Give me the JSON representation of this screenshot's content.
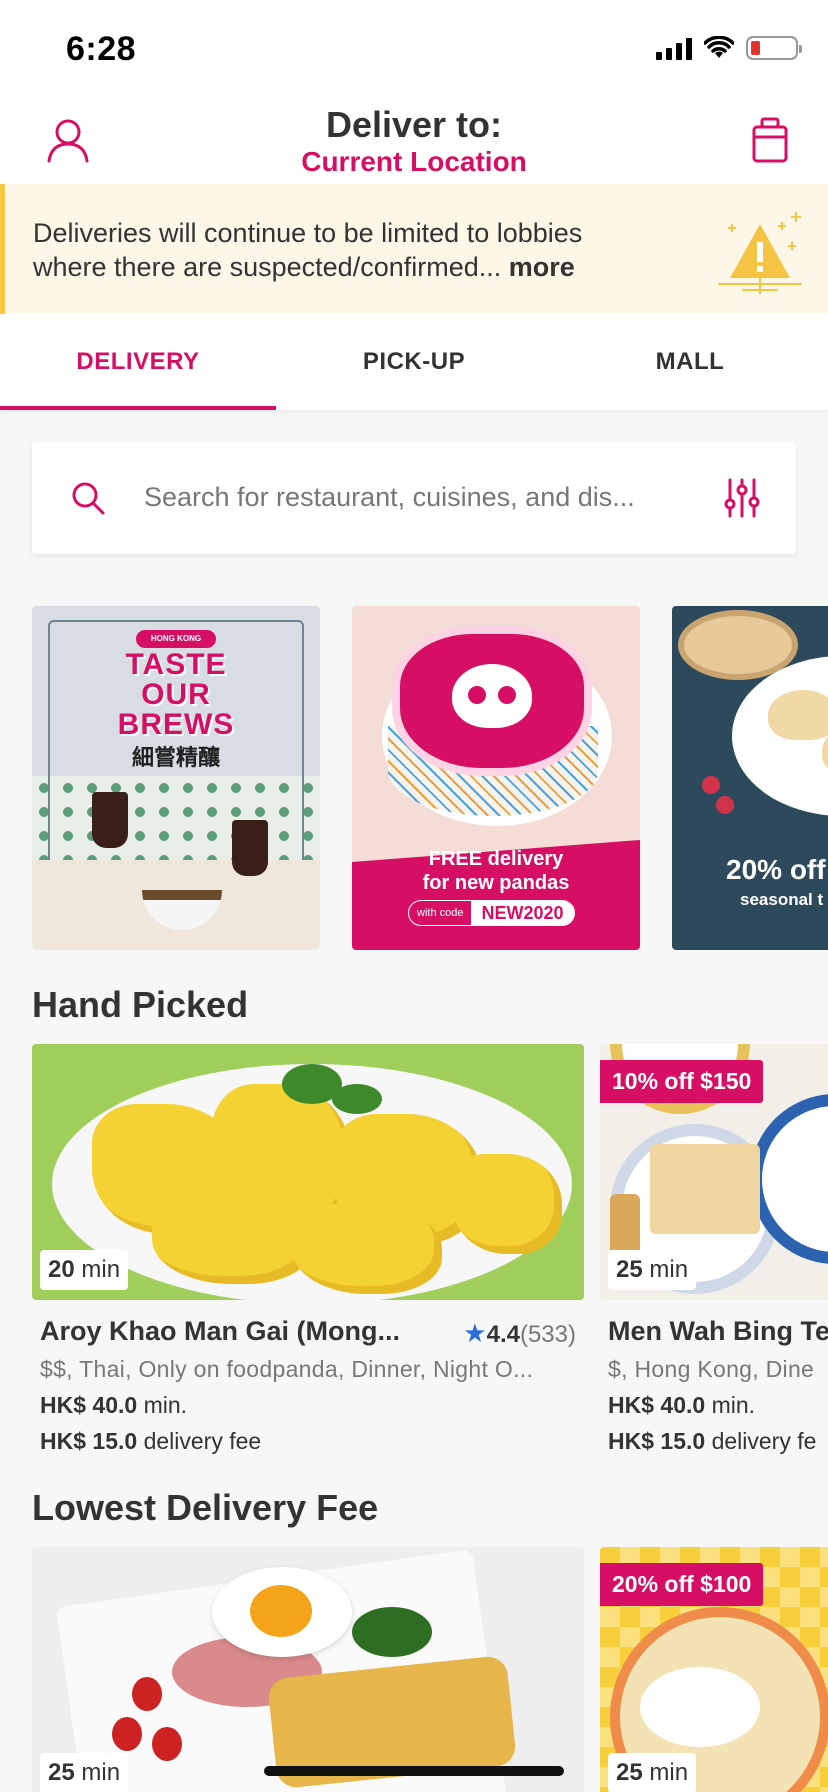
{
  "status_bar": {
    "time": "6:28"
  },
  "header": {
    "title": "Deliver to:",
    "location": "Current Location"
  },
  "notice": {
    "text": "Deliveries will continue to be limited to lobbies where there are suspected/confirmed...",
    "more_label": "more"
  },
  "tabs": [
    {
      "label": "DELIVERY",
      "active": true
    },
    {
      "label": "PICK-UP",
      "active": false
    },
    {
      "label": "MALL",
      "active": false
    }
  ],
  "search": {
    "placeholder": "Search for restaurant, cuisines, and dis..."
  },
  "banners": [
    {
      "brand": "HONG KONG",
      "title_lines": [
        "TASTE",
        "OUR",
        "BREWS"
      ],
      "subtitle": "細嘗精釀"
    },
    {
      "line1": "FREE delivery",
      "line2": "for new pandas",
      "code_label": "with code",
      "code": "NEW2020"
    },
    {
      "line1": "20% off",
      "line2": "seasonal t"
    }
  ],
  "sections": {
    "hand_picked": {
      "title": "Hand Picked",
      "cards": [
        {
          "time_value": "20",
          "time_unit": "min",
          "name": "Aroy Khao Man Gai (Mong...",
          "rating": "4.4",
          "rating_count": "(533)",
          "tags": "$$, Thai, Only on foodpanda, Dinner, Night O...",
          "min_order": "HK$ 40.0",
          "min_suffix": "min.",
          "delivery_fee": "HK$ 15.0",
          "fee_suffix": "delivery fee"
        },
        {
          "discount": "10% off $150",
          "time_value": "25",
          "time_unit": "min",
          "name": "Men Wah Bing Te",
          "tags": "$, Hong Kong, Dine",
          "min_order": "HK$ 40.0",
          "min_suffix": "min.",
          "delivery_fee": "HK$ 15.0",
          "fee_suffix": "delivery fe"
        }
      ]
    },
    "lowest_fee": {
      "title": "Lowest Delivery Fee",
      "cards": [
        {
          "time_value": "25",
          "time_unit": "min"
        },
        {
          "discount": "20% off $100",
          "time_value": "25",
          "time_unit": "min"
        }
      ]
    }
  },
  "colors": {
    "brand": "#d70f64",
    "notice_bg": "#fdf7e7",
    "notice_accent": "#f7c943",
    "rating_star": "#2f6dd6"
  },
  "icons": [
    "profile-icon",
    "cart-icon",
    "warning-icon",
    "search-icon",
    "filter-icon",
    "star-icon"
  ]
}
